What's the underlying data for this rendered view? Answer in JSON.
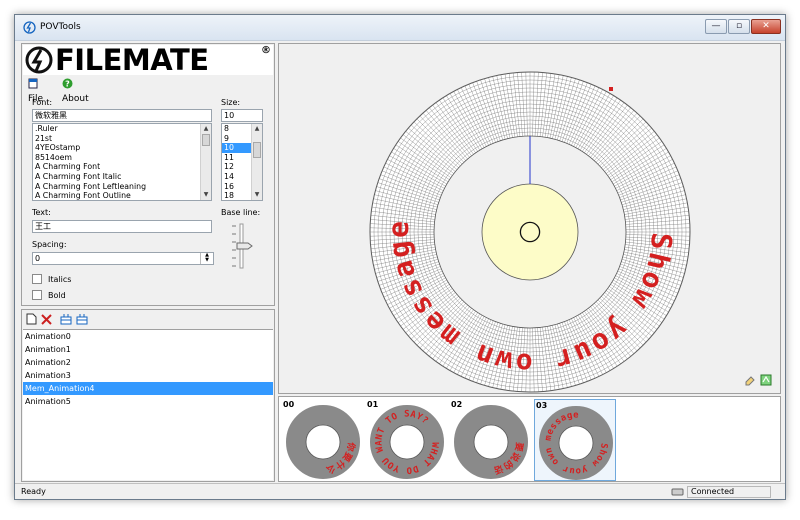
{
  "window": {
    "title": "POVTools"
  },
  "logo": {
    "text": "FILEMATE",
    "mark": "®"
  },
  "menu": {
    "file": "File",
    "about": "About"
  },
  "font": {
    "label": "Font:",
    "value": "微软雅黑",
    "options": [
      ".Ruler",
      "21st",
      "4YEOstamp",
      "8514oem",
      "A Charming Font",
      "A Charming Font Italic",
      "A Charming Font Leftleaning",
      "A Charming Font Outline"
    ]
  },
  "size": {
    "label": "Size:",
    "value": "10",
    "options": [
      "8",
      "9",
      "10",
      "11",
      "12",
      "14",
      "16",
      "18"
    ],
    "selected_index": 2
  },
  "text_field": {
    "label": "Text:",
    "value": "王工"
  },
  "spacing": {
    "label": "Spacing:",
    "value": "0"
  },
  "baseline": {
    "label": "Base line:"
  },
  "options": {
    "italics": "Italics",
    "bold": "Bold"
  },
  "animations": {
    "items": [
      "Animation0",
      "Animation1",
      "Animation2",
      "Animation3",
      "Mem_Animation4",
      "Animation5"
    ],
    "selected_index": 4
  },
  "disc": {
    "text": "Show your own message",
    "text_color": "#d42020",
    "disc_color": "#8a8a8a",
    "hub_color": "#fdfcc8"
  },
  "thumbnails": [
    {
      "label": "00",
      "text": "你要什么"
    },
    {
      "label": "01",
      "text": "WHAT DO YOU WANT TO SAY?"
    },
    {
      "label": "02",
      "text": "要说的话"
    },
    {
      "label": "03",
      "text": "Show your own message"
    }
  ],
  "thumbnail_selected_index": 3,
  "status": {
    "left": "Ready",
    "right": "Connected"
  },
  "colors": {
    "selection": "#3399ff",
    "accent_blue": "#1565c0"
  }
}
